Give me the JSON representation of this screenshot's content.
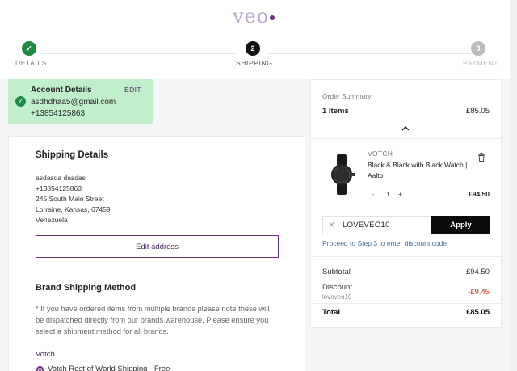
{
  "brand": {
    "logo_text": "veo",
    "color": "#6a2c7b"
  },
  "steps": [
    {
      "number": "",
      "label": "DETAILS",
      "state": "done"
    },
    {
      "number": "2",
      "label": "SHIPPING",
      "state": "active"
    },
    {
      "number": "3",
      "label": "PAYMENT",
      "state": "upcoming"
    }
  ],
  "account": {
    "title": "Account Details",
    "edit_label": "EDIT",
    "email": "asdhdhaa5@gmail.com",
    "phone": "+13854125863"
  },
  "shipping": {
    "title": "Shipping Details",
    "address_lines": [
      "asdasda dasdas",
      "+13854125863",
      "245 South Main Street",
      "Lorraine, Kansas, 67459",
      "Venezuela"
    ],
    "edit_address_label": "Edit address",
    "method_title": "Brand Shipping Method",
    "method_note": "* If you have ordered items from multiple brands please note these will be dispatched directly from our brands warehouse. Please ensure you select a shipment method for all brands.",
    "brand_name": "Votch",
    "option_label": "Votch Rest of World Shipping - Free"
  },
  "summary": {
    "title": "Order Summary",
    "items_label": "1 Items",
    "items_total": "£85.05",
    "product": {
      "brand": "VOTCH",
      "name": "Black & Black with Black Watch | Aalto",
      "qty_minus": "-",
      "qty": "1",
      "qty_plus": "+",
      "price": "£94.50"
    },
    "discount_input": "LOVEVEO10",
    "apply_label": "Apply",
    "discount_hint": "Proceed to Step 3 to enter discount code",
    "subtotal_label": "Subtotal",
    "subtotal_value": "£94.50",
    "discount_label": "Discount",
    "discount_code": "loveveo10",
    "discount_value": "-£9.45",
    "total_label": "Total",
    "total_value": "£85.05"
  }
}
